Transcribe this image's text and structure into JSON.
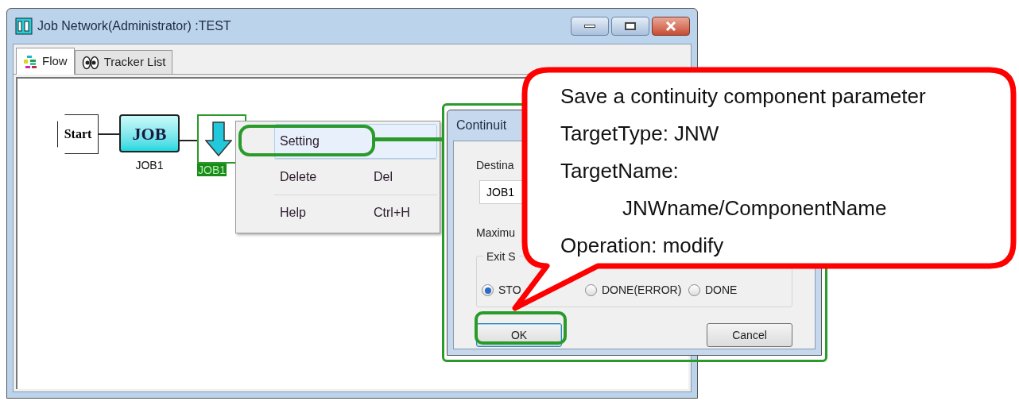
{
  "window": {
    "title": "Job Network(Administrator) :TEST"
  },
  "tabs": [
    {
      "label": "Flow",
      "selected": true,
      "kind": "flow"
    },
    {
      "label": "Tracker List",
      "selected": false,
      "kind": "tracker"
    }
  ],
  "flow": {
    "nodes": [
      {
        "kind": "start",
        "label": "Start"
      },
      {
        "kind": "job",
        "label": "JOB",
        "caption": "JOB1"
      },
      {
        "kind": "continuity",
        "caption": "JOB1",
        "selected": true
      }
    ]
  },
  "context_menu": {
    "items": [
      {
        "label": "Setting",
        "selected": true
      },
      {
        "label": "Delete",
        "shortcut": "Del",
        "selected": false
      },
      {
        "label": "Help",
        "shortcut": "Ctrl+H",
        "selected": false
      }
    ]
  },
  "dialog": {
    "title": "Continuit",
    "destination_label": "Destina",
    "destination_value": "JOB1",
    "maximum_label": "Maximu",
    "exit_group_label": "Exit S",
    "options": [
      {
        "label": "STO",
        "selected": true
      },
      {
        "label": "DONE(ERROR)",
        "selected": false
      },
      {
        "label": "DONE",
        "selected": false
      }
    ],
    "buttons": [
      {
        "label": "OK",
        "kind": "ok"
      },
      {
        "label": "Cancel",
        "kind": "cancel"
      }
    ]
  },
  "callout": {
    "lines": [
      {
        "text": "Save a continuity component parameter",
        "indent": false
      },
      {
        "text": "TargetType: JNW",
        "indent": false
      },
      {
        "text": "TargetName:",
        "indent": false
      },
      {
        "text": "JNWname/ComponentName",
        "indent": true
      },
      {
        "text": "Operation: modify",
        "indent": false
      }
    ]
  }
}
